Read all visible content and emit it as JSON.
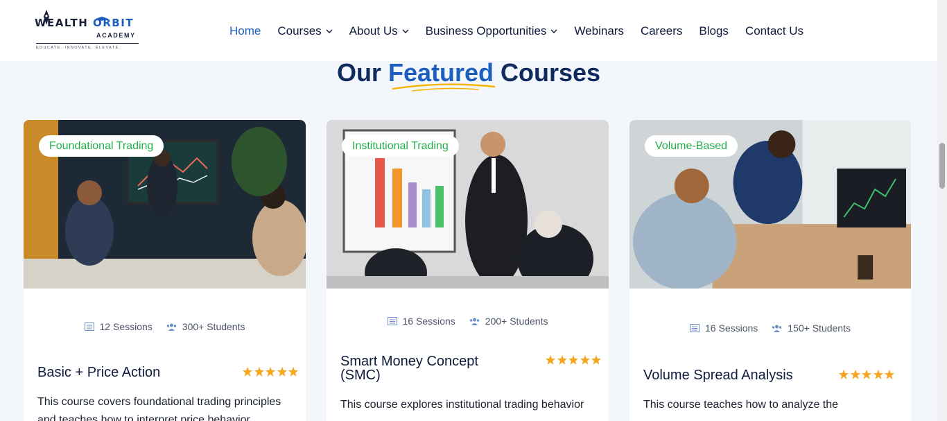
{
  "brand": {
    "wordmark_a": "WEALTH",
    "wordmark_b": "ORBIT",
    "sub": "ACADEMY",
    "tagline": "EDUCATE. INNOVATE. ELEVATE."
  },
  "nav": {
    "items": [
      {
        "label": "Home",
        "active": true,
        "dropdown": false
      },
      {
        "label": "Courses",
        "active": false,
        "dropdown": true
      },
      {
        "label": "About Us",
        "active": false,
        "dropdown": true
      },
      {
        "label": "Business Opportunities",
        "active": false,
        "dropdown": true
      },
      {
        "label": "Webinars",
        "active": false,
        "dropdown": false
      },
      {
        "label": "Careers",
        "active": false,
        "dropdown": false
      },
      {
        "label": "Blogs",
        "active": false,
        "dropdown": false
      },
      {
        "label": "Contact Us",
        "active": false,
        "dropdown": false
      }
    ]
  },
  "section": {
    "title_pre": "Our ",
    "title_highlight": "Featured",
    "title_post": " Courses"
  },
  "courses": [
    {
      "tag": "Foundational Trading",
      "sessions": "12 Sessions",
      "students": "300+ Students",
      "title": "Basic + Price Action",
      "rating": 5,
      "description": "This course covers foundational trading principles and teaches how to interpret price behavior"
    },
    {
      "tag": "Institutional Trading",
      "sessions": "16 Sessions",
      "students": "200+ Students",
      "title": "Smart Money Concept (SMC)",
      "rating": 5,
      "description": "This course explores institutional trading behavior"
    },
    {
      "tag": "Volume-Based",
      "sessions": "16 Sessions",
      "students": "150+ Students",
      "title": "Volume Spread Analysis",
      "rating": 5,
      "description": "This course teaches how to analyze the"
    }
  ],
  "colors": {
    "accent": "#1c5fbf",
    "badge_text": "#23b04a",
    "star": "#f5a623",
    "heading": "#0f2a5c"
  }
}
